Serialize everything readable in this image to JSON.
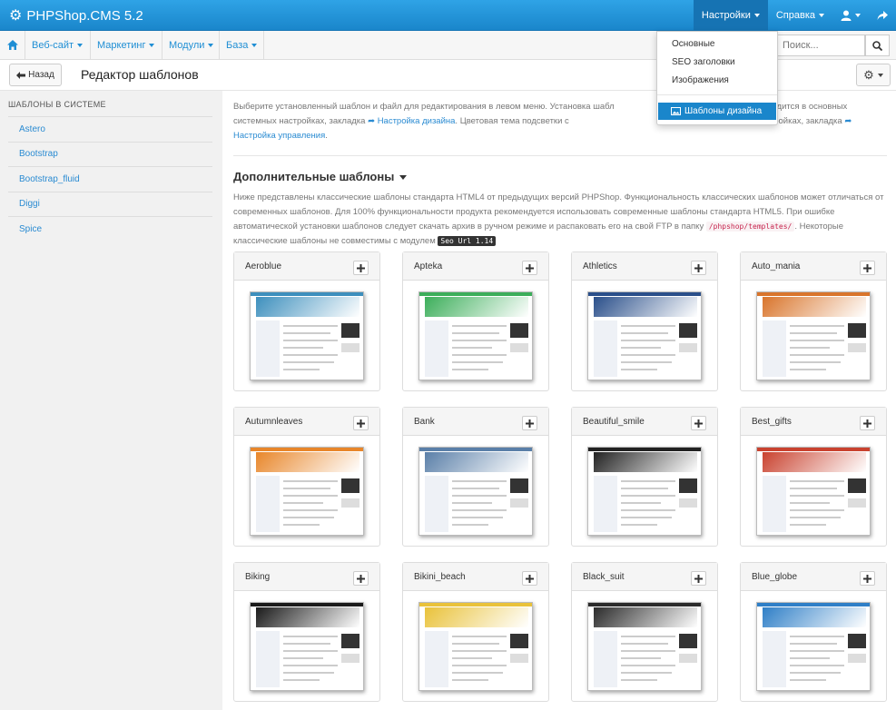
{
  "app": {
    "title": "PHPShop.CMS 5.2"
  },
  "topnav": {
    "settings_label": "Настройки",
    "help_label": "Справка",
    "user_icon": "user-icon",
    "external_icon": "share-arrow-icon"
  },
  "secnav": {
    "items": [
      {
        "label": "Веб-сайт"
      },
      {
        "label": "Маркетинг"
      },
      {
        "label": "Модули"
      },
      {
        "label": "База"
      }
    ]
  },
  "search": {
    "placeholder": "Поиск..."
  },
  "dropdown": {
    "items": [
      {
        "label": "Основные"
      },
      {
        "label": "SEO заголовки"
      },
      {
        "label": "Изображения"
      }
    ],
    "active_label": "Шаблоны дизайна"
  },
  "toolbar": {
    "back_label": "Назад",
    "page_title": "Редактор шаблонов",
    "settings_icon": "gear-icon"
  },
  "sidebar": {
    "heading": "ШАБЛОНЫ В СИСТЕМЕ",
    "items": [
      {
        "label": "Astero"
      },
      {
        "label": "Bootstrap"
      },
      {
        "label": "Bootstrap_fluid"
      },
      {
        "label": "Diggi"
      },
      {
        "label": "Spice"
      }
    ]
  },
  "intro": {
    "text1": "Выберите установленный шаблон и файл для редактирования в левом меню. Установка шабл",
    "text1b": "йте производится в основных системных настройках, закладка",
    "link1": "Настройка дизайна",
    "text2": ". Цветовая тема подсветки с",
    "text2b": "ных системных настройках, закладка",
    "link2": "Настройка управления",
    "text3": "."
  },
  "section": {
    "title": "Дополнительные шаблоны"
  },
  "description": {
    "text": "Ниже представлены классические шаблоны стандарта HTML4 от предыдущих версий PHPShop. Функциональность классических шаблонов может отличаться от современных шаблонов. Для 100% функциональности продукта рекомендуется использовать современные шаблоны стандарта HTML5. При ошибке автоматической установки шаблонов следует скачать архив в ручном режиме и распаковать его на свой FTP в папку",
    "path": "/phpshop/templates/",
    "text_after": ". Некоторые классические шаблоны не совместимы с модулем",
    "module": "Seo Url 1.14"
  },
  "templates": [
    {
      "name": "Aeroblue",
      "accent": "#3d8fbd"
    },
    {
      "name": "Apteka",
      "accent": "#3cae5a"
    },
    {
      "name": "Athletics",
      "accent": "#2a4f8a"
    },
    {
      "name": "Auto_mania",
      "accent": "#d9752c"
    },
    {
      "name": "Autumnleaves",
      "accent": "#e8862a"
    },
    {
      "name": "Bank",
      "accent": "#5a7fa8"
    },
    {
      "name": "Beautiful_smile",
      "accent": "#222222"
    },
    {
      "name": "Best_gifts",
      "accent": "#c9422f"
    },
    {
      "name": "Biking",
      "accent": "#1a1a1a"
    },
    {
      "name": "Bikini_beach",
      "accent": "#e9c23a"
    },
    {
      "name": "Black_suit",
      "accent": "#2b2b2b"
    },
    {
      "name": "Blue_globe",
      "accent": "#2f7fc7"
    }
  ]
}
